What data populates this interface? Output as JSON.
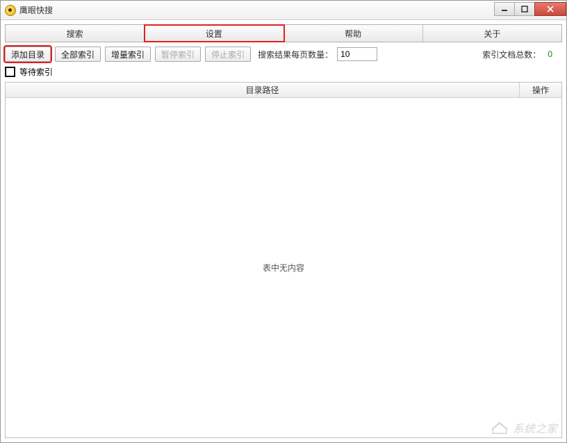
{
  "window": {
    "title": "鹰眼快搜"
  },
  "tabs": [
    {
      "label": "搜索",
      "highlighted": false
    },
    {
      "label": "设置",
      "highlighted": true
    },
    {
      "label": "帮助",
      "highlighted": false
    },
    {
      "label": "关于",
      "highlighted": false
    }
  ],
  "toolbar": {
    "add_dir": "添加目录",
    "full_index": "全部索引",
    "inc_index": "增量索引",
    "pause_index": "暂停索引",
    "stop_index": "停止索引",
    "results_per_page_label": "搜索结果每页数量：",
    "results_per_page_value": "10",
    "index_docs_total_label": "索引文档总数：",
    "index_docs_total_value": "0"
  },
  "checkbox": {
    "wait_index_label": "等待索引",
    "checked": false
  },
  "table": {
    "headers": {
      "path": "目录路径",
      "op": "操作"
    },
    "empty_text": "表中无内容",
    "rows": []
  },
  "watermark": "系统之家"
}
